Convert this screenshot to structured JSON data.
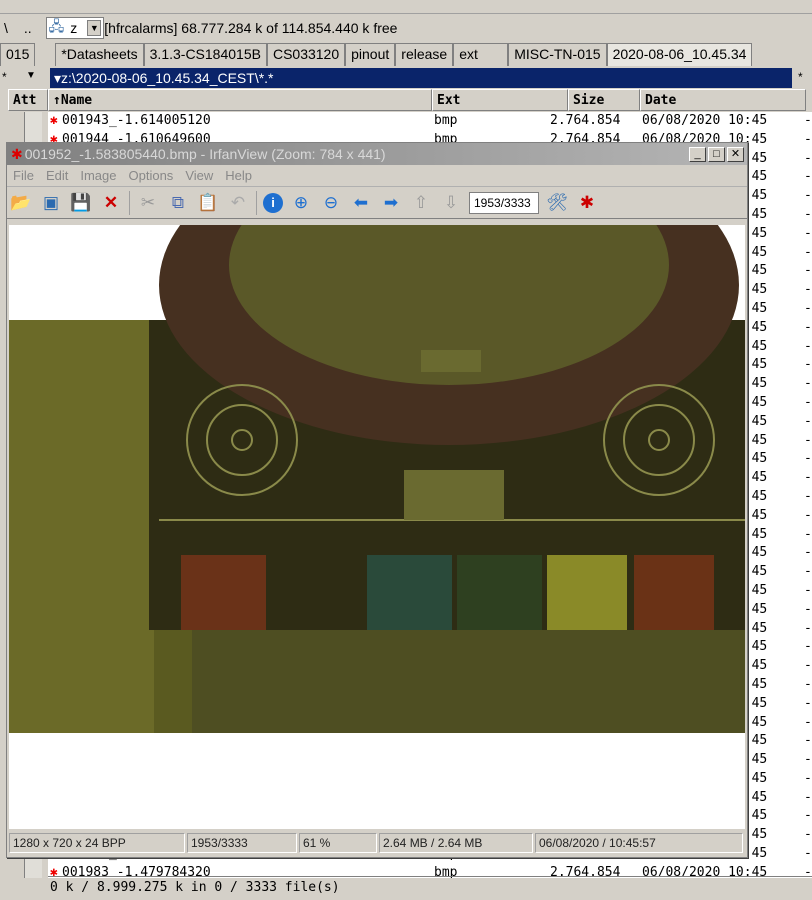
{
  "commander": {
    "drive_nav": [
      "\\",
      ".."
    ],
    "drive": "z",
    "drive_info": "[hfrcalarms]  68.777.284 k of 114.854.440 k free",
    "left_tab": "015",
    "tabs": [
      "*Datasheets",
      "3.1.3-CS184015B",
      "CS033120",
      "pinout",
      "release",
      "ext",
      "MISC-TN-015",
      "2020-08-06_10.45.34"
    ],
    "active_tab": 7,
    "path": "▾z:\\2020-08-06_10.45.34_CEST\\*.*",
    "left_header": "Att",
    "columns": {
      "name": "↑Name",
      "ext": "Ext",
      "size": "Size",
      "date": "Date"
    },
    "rows": [
      {
        "name": "001943_-1.614005120",
        "ext": "bmp",
        "size": "2.764.854",
        "date": "06/08/2020 10:45",
        "attr": "-"
      },
      {
        "name": "001944_-1.610649600",
        "ext": "bmp",
        "size": "2.764.854",
        "date": "06/08/2020 10:45",
        "attr": "-"
      },
      {
        "name": "001983_-1.479784320",
        "ext": "bmp",
        "size": "2.764.854",
        "date": "06/08/2020 10:45",
        "attr": "-"
      }
    ],
    "status": "0 k / 8.999.275 k in 0 / 3333 file(s)"
  },
  "irfanview": {
    "title": "001952_-1.583805440.bmp - IrfanView (Zoom: 784 x 441)",
    "menu": [
      "File",
      "Edit",
      "Image",
      "Options",
      "View",
      "Help"
    ],
    "page_field": "1953/3333",
    "status": [
      "1280 x 720 x 24 BPP",
      "1953/3333",
      "61 %",
      "2.64 MB / 2.64 MB",
      "06/08/2020 / 10:45:57"
    ],
    "toolbar_icons": [
      "open-icon",
      "thumbnails-icon",
      "save-icon",
      "delete-icon",
      "cut-icon",
      "copy-icon",
      "paste-icon",
      "undo-icon",
      "info-icon",
      "zoom-in-icon",
      "zoom-out-icon",
      "previous-icon",
      "next-icon",
      "first-icon",
      "last-icon",
      "settings-icon",
      "irfanview-logo-icon"
    ]
  }
}
